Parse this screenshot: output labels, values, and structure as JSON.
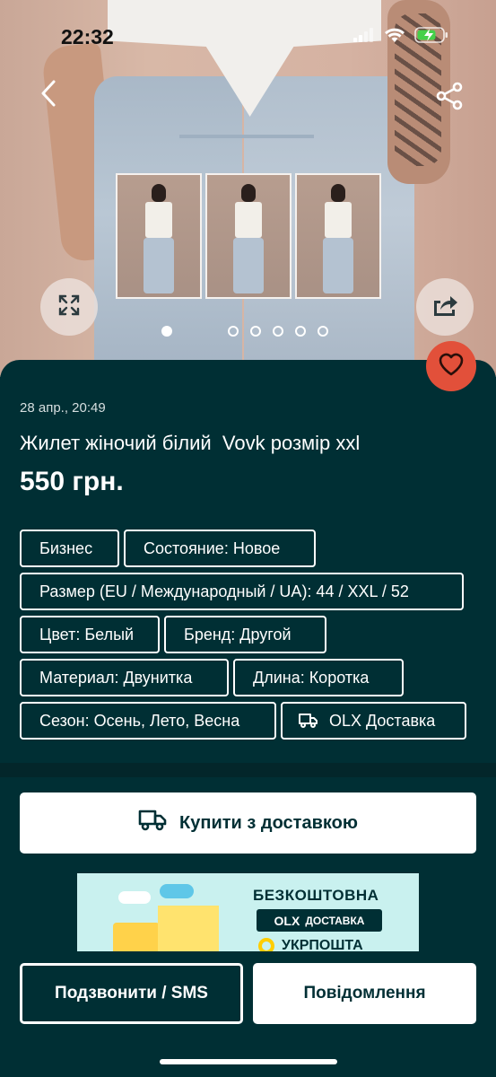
{
  "status_bar": {
    "time": "22:32"
  },
  "listing": {
    "date": "28 апр., 20:49",
    "title": "Жилет жіночий білий  Vovk розмір xxl",
    "price": "550 грн.",
    "photos": {
      "count": 6,
      "active_index": 0
    }
  },
  "tags": [
    {
      "label": "Бизнес"
    },
    {
      "label": "Состояние: Новое"
    },
    {
      "label": "Размер (EU / Международный / UA): 44 / XXL / 52"
    },
    {
      "label": "Цвет: Белый"
    },
    {
      "label": "Бренд: Другой"
    },
    {
      "label": "Материал: Двунитка"
    },
    {
      "label": "Длина: Коротка"
    },
    {
      "label": "Сезон: Осень, Лето, Весна"
    },
    {
      "label": "OLX Доставка",
      "icon": "truck-icon"
    }
  ],
  "buy_button": {
    "label": "Купити з доставкою",
    "icon": "truck-icon"
  },
  "promo": {
    "line1": "БЕЗКОШТОВНА",
    "badge_logo": "OLX",
    "badge_text": "ДОСТАВКА",
    "line3": "УКРПОШТА"
  },
  "actions": {
    "call_label": "Подзвонити / SMS",
    "message_label": "Повідомлення"
  },
  "colors": {
    "background": "#002f34",
    "favorite": "#e2503a",
    "text": "#ffffff"
  }
}
